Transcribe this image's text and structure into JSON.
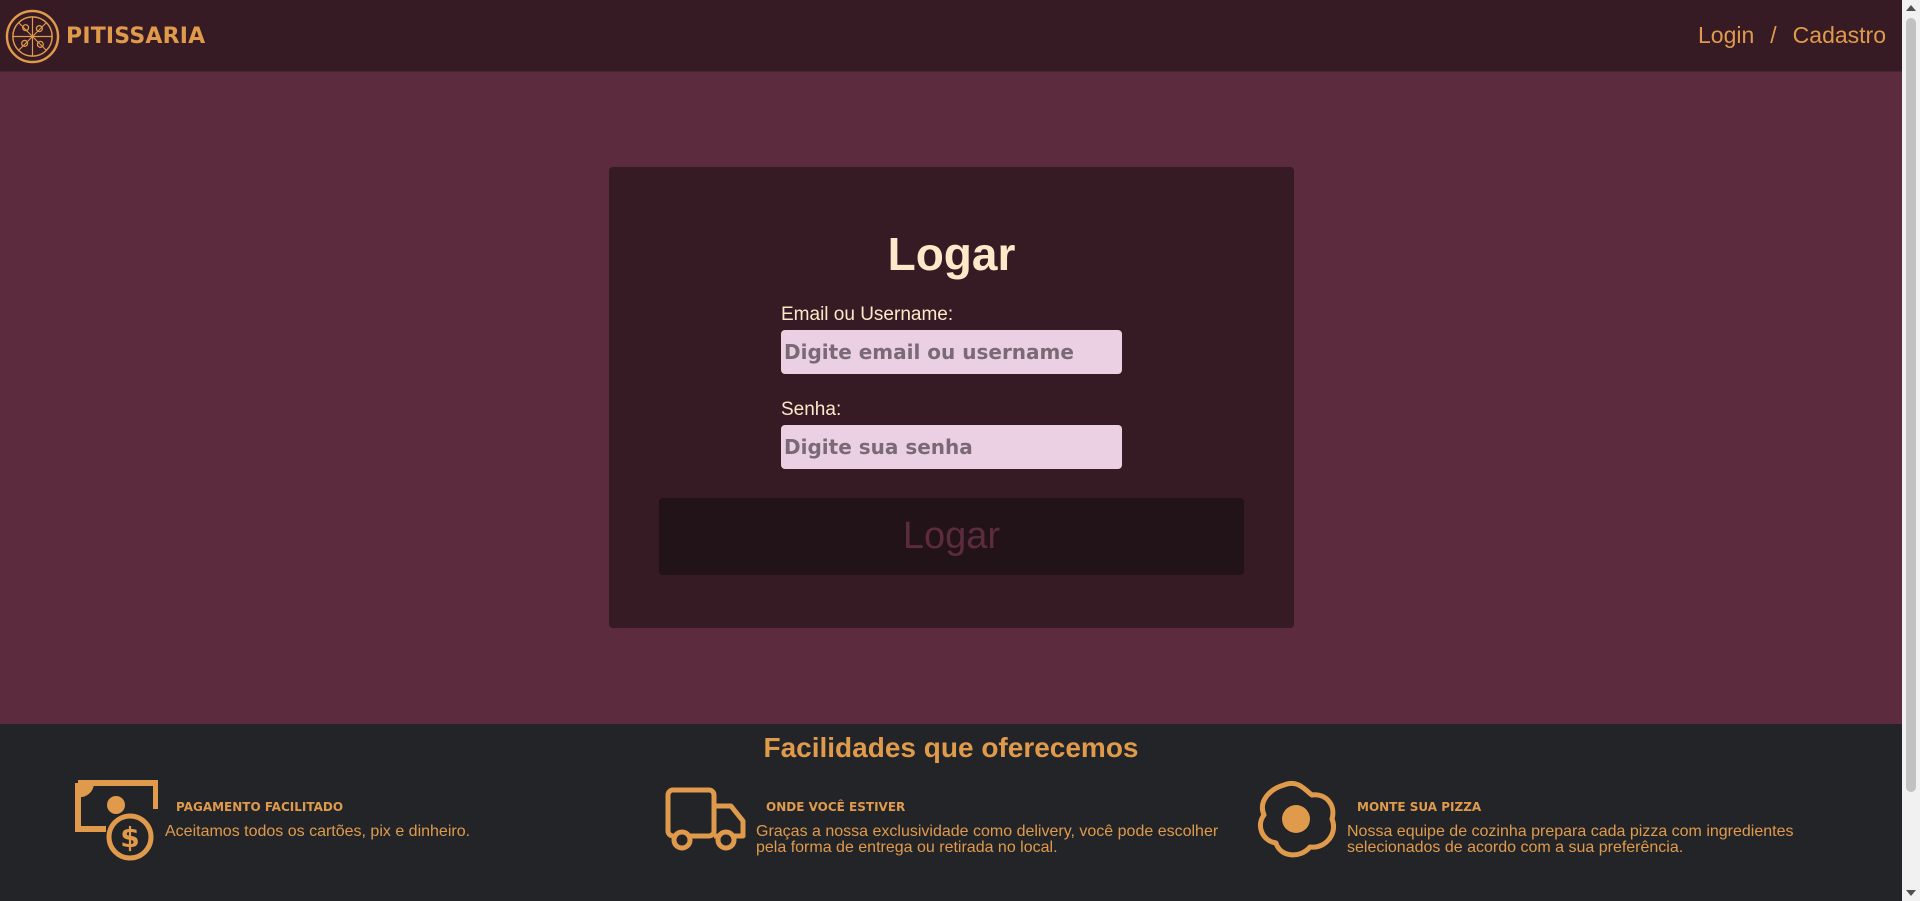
{
  "header": {
    "brand": "PITISSARIA",
    "nav": {
      "login": "Login",
      "separator": "/",
      "register": "Cadastro"
    }
  },
  "login_form": {
    "title": "Logar",
    "email_label": "Email ou Username:",
    "email_placeholder": "Digite email ou username",
    "password_label": "Senha:",
    "password_placeholder": "Digite sua senha",
    "submit_label": "Logar"
  },
  "footer": {
    "title": "Facilidades que oferecemos",
    "features": [
      {
        "icon": "money-icon",
        "title": "PAGAMENTO FACILITADO",
        "description": "Aceitamos todos os cartões, pix e dinheiro."
      },
      {
        "icon": "truck-icon",
        "title": "ONDE VOCÊ ESTIVER",
        "description": "Graças a nossa exclusividade como delivery, você pode escolher pela forma de entrega ou retirada no local."
      },
      {
        "icon": "egg-icon",
        "title": "MONTE SUA PIZZA",
        "description": "Nossa equipe de cozinha prepara cada pizza com ingredientes selecionados de acordo com a sua preferência."
      }
    ]
  },
  "colors": {
    "header_bg": "#361a24",
    "page_bg": "#5c2b3d",
    "accent": "#e09a4c",
    "cream": "#fde9c9",
    "input_bg": "#ebcfe3",
    "footer_bg": "#222428"
  }
}
